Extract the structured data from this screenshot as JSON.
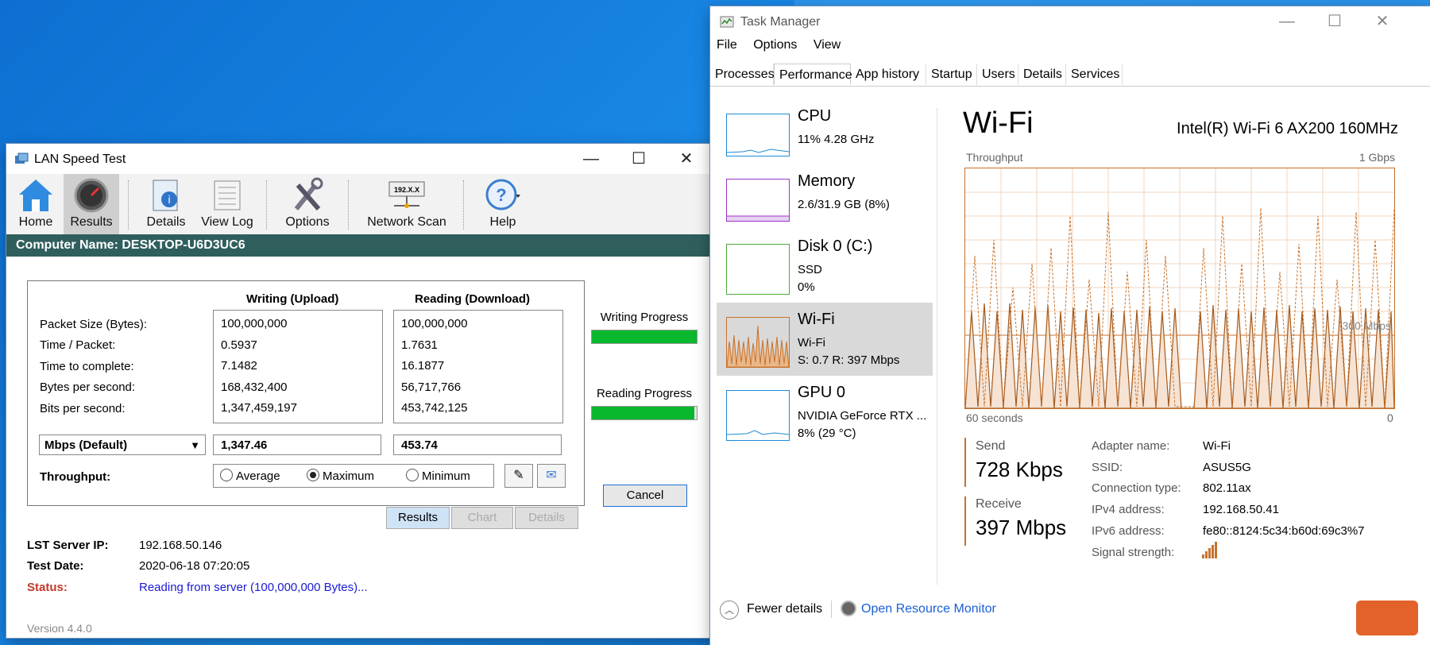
{
  "lan_speed_test": {
    "title": "LAN Speed Test",
    "window_controls": {
      "minimize": "—",
      "maximize": "☐",
      "close": "✕"
    },
    "toolbar": {
      "home": "Home",
      "results": "Results",
      "details": "Details",
      "view_log": "View Log",
      "options": "Options",
      "network_scan": "Network Scan",
      "help": "Help",
      "network_scan_icon_text": "192.X.X"
    },
    "computer_name": "Computer Name: DESKTOP-U6D3UC6",
    "results": {
      "col_write": "Writing (Upload)",
      "col_read": "Reading (Download)",
      "row_labels": [
        "Packet Size (Bytes):",
        "Time / Packet:",
        "Time to complete:",
        "Bytes per second:",
        "Bits per second:"
      ],
      "write_values": [
        "100,000,000",
        "0.5937",
        "7.1482",
        "168,432,400",
        "1,347,459,197"
      ],
      "read_values": [
        "100,000,000",
        "1.7631",
        "16.1877",
        "56,717,766",
        "453,742,125"
      ],
      "unit_select": "Mbps (Default)",
      "write_result": "1,347.46",
      "read_result": "453.74",
      "throughput_label": "Throughput:",
      "radio_options": {
        "average": "Average",
        "maximum": "Maximum",
        "minimum": "Minimum"
      },
      "selected_radio": "maximum"
    },
    "progress": {
      "writing_label": "Writing Progress",
      "writing_value": 1.0,
      "reading_label": "Reading Progress",
      "reading_value": 0.98
    },
    "cancel_label": "Cancel",
    "result_tabs": {
      "results": "Results",
      "chart": "Chart",
      "details": "Details"
    },
    "info": {
      "server_ip_label": "LST Server IP:",
      "server_ip": "192.168.50.146",
      "test_date_label": "Test Date:",
      "test_date": "2020-06-18 07:20:05",
      "status_label": "Status:",
      "status": "Reading from server (100,000,000 Bytes)..."
    },
    "version": "Version 4.4.0",
    "colors": {
      "header_bar": "#2f5f5d",
      "progress": "#0ab82d",
      "status_label": "#c0392b",
      "status_text": "#1a1ad6"
    }
  },
  "task_manager": {
    "title": "Task Manager",
    "window_controls": {
      "minimize": "—",
      "maximize": "☐",
      "close": "✕"
    },
    "menu": [
      "File",
      "Options",
      "View"
    ],
    "tabs": [
      "Processes",
      "Performance",
      "App history",
      "Startup",
      "Users",
      "Details",
      "Services"
    ],
    "active_tab": "Performance",
    "resources": [
      {
        "name": "CPU",
        "line2": "11%  4.28 GHz",
        "line3": ""
      },
      {
        "name": "Memory",
        "line2": "2.6/31.9 GB (8%)",
        "line3": ""
      },
      {
        "name": "Disk 0 (C:)",
        "line2": "SSD",
        "line3": "0%"
      },
      {
        "name": "Wi-Fi",
        "line2": "Wi-Fi",
        "line3": "S: 0.7  R: 397 Mbps"
      },
      {
        "name": "GPU 0",
        "line2": "NVIDIA GeForce RTX ...",
        "line3": "8%  (29 °C)"
      }
    ],
    "detail": {
      "heading": "Wi-Fi",
      "adapter": "Intel(R) Wi-Fi 6 AX200 160MHz",
      "throughput_label": "Throughput",
      "max_label": "1 Gbps",
      "mid_label": "300 Mbps",
      "time_left": "60 seconds",
      "time_right": "0",
      "send_label": "Send",
      "send_value": "728 Kbps",
      "receive_label": "Receive",
      "receive_value": "397 Mbps",
      "props": [
        {
          "label": "Adapter name:",
          "value": "Wi-Fi"
        },
        {
          "label": "SSID:",
          "value": "ASUS5G"
        },
        {
          "label": "Connection type:",
          "value": "802.11ax"
        },
        {
          "label": "IPv4 address:",
          "value": "192.168.50.41"
        },
        {
          "label": "IPv6 address:",
          "value": "fe80::8124:5c34:b60d:69c3%7"
        },
        {
          "label": "Signal strength:",
          "value": ""
        }
      ]
    },
    "footer": {
      "fewer": "Fewer details",
      "resmon": "Open Resource Monitor"
    },
    "colors": {
      "wifi": "#c7722c",
      "cpu": "#1f8ad6",
      "memory": "#9b35c8",
      "disk": "#4daa3c",
      "gpu": "#1f8ad6",
      "link": "#1a5fd6"
    }
  }
}
